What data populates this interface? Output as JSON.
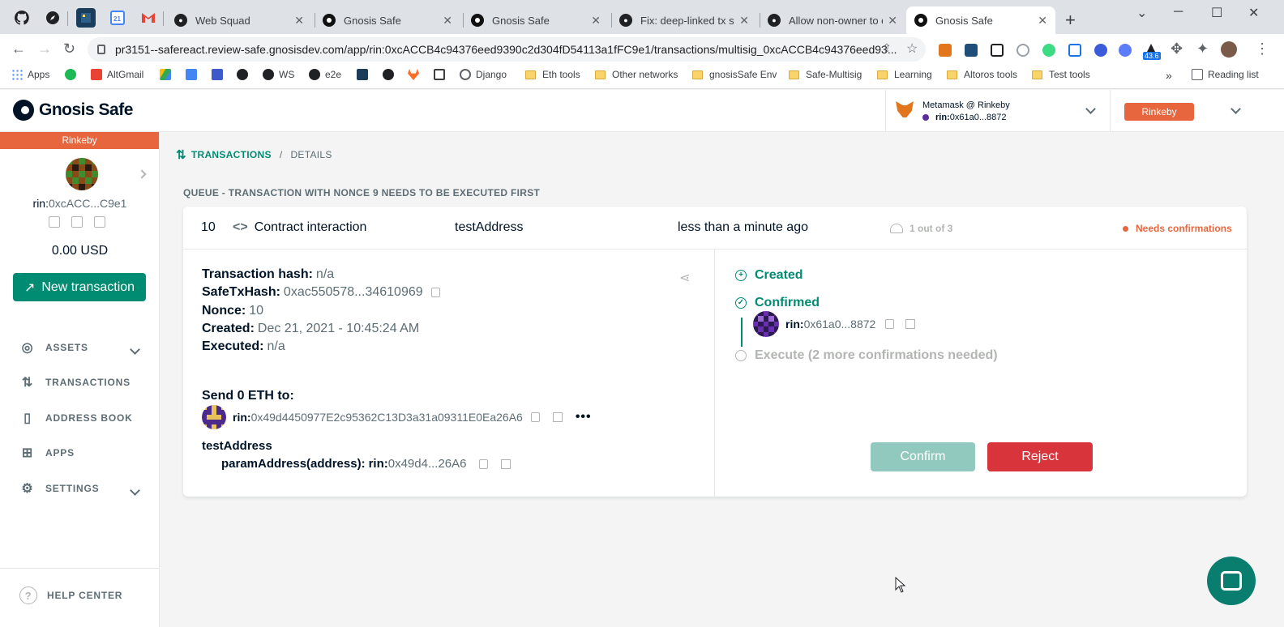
{
  "browser": {
    "tabs": [
      {
        "title": "Web Squad",
        "icon": "github-icon"
      },
      {
        "title": "Gnosis Safe",
        "icon": "gnosis-icon"
      },
      {
        "title": "Gnosis Safe",
        "icon": "gnosis-icon"
      },
      {
        "title": "Fix: deep-linked tx stat",
        "icon": "github-icon"
      },
      {
        "title": "Allow non-owner to ex",
        "icon": "github-icon"
      },
      {
        "title": "Gnosis Safe",
        "icon": "gnosis-icon",
        "active": true
      }
    ],
    "url": "pr3151--safereact.review-safe.gnosisdev.com/app/rin:0xcACCB4c94376eed9390c2d304fD54113a1fFC9e1/transactions/multisig_0xcACCB4c94376eed93...",
    "extension_badge": "43.6",
    "bookmarks": {
      "apps": "Apps",
      "altgmail": "AltGmail",
      "ws": "WS",
      "e2e": "e2e",
      "django": "Django",
      "eth_tools": "Eth tools",
      "other_networks": "Other networks",
      "gnosissafe_env": "gnosisSafe Env",
      "safe_multisig": "Safe-Multisig",
      "learning": "Learning",
      "altoros_tools": "Altoros tools",
      "test_tools": "Test tools",
      "reading_list": "Reading list"
    }
  },
  "header": {
    "logo": "Gnosis Safe",
    "wallet_name": "Metamask @ Rinkeby",
    "wallet_prefix": "rin:",
    "wallet_addr": "0x61a0...8872",
    "network": "Rinkeby"
  },
  "sidebar": {
    "network": "Rinkeby",
    "addr_prefix": "rin:",
    "addr": "0xcACC...C9e1",
    "balance": "0.00 USD",
    "new_tx": "New transaction",
    "items": [
      {
        "label": "ASSETS"
      },
      {
        "label": "TRANSACTIONS"
      },
      {
        "label": "ADDRESS BOOK"
      },
      {
        "label": "APPS"
      },
      {
        "label": "SETTINGS"
      }
    ],
    "help": "HELP CENTER"
  },
  "breadcrumb": {
    "section": "TRANSACTIONS",
    "sep": "/",
    "page": "DETAILS"
  },
  "queue_heading": "QUEUE - TRANSACTION WITH NONCE 9 NEEDS TO BE EXECUTED FIRST",
  "tx": {
    "nonce": "10",
    "type": "Contract interaction",
    "method": "testAddress",
    "time": "less than a minute ago",
    "confirmations": "1 out of 3",
    "status": "Needs confirmations",
    "details": {
      "hash_label": "Transaction hash:",
      "hash": "n/a",
      "safetx_label": "SafeTxHash:",
      "safetx": "0xac550578...34610969",
      "nonce_label": "Nonce:",
      "nonce": "10",
      "created_label": "Created:",
      "created": "Dec 21, 2021 - 10:45:24 AM",
      "executed_label": "Executed:",
      "executed": "n/a",
      "send_label": "Send 0 ETH to:",
      "to_prefix": "rin:",
      "to_addr": "0x49d4450977E2c95362C13D3a31a09311E0Ea26A6",
      "method": "testAddress",
      "param_label": "paramAddress(address):",
      "param_prefix": "rin:",
      "param_addr": "0x49d4...26A6"
    },
    "timeline": {
      "created": "Created",
      "confirmed": "Confirmed",
      "owner_prefix": "rin:",
      "owner_addr": "0x61a0...8872",
      "execute": "Execute (2 more confirmations needed)"
    },
    "actions": {
      "confirm": "Confirm",
      "reject": "Reject"
    }
  },
  "colors": {
    "accent": "#008c73",
    "network": "#e8663d",
    "reject": "#d8343b"
  }
}
